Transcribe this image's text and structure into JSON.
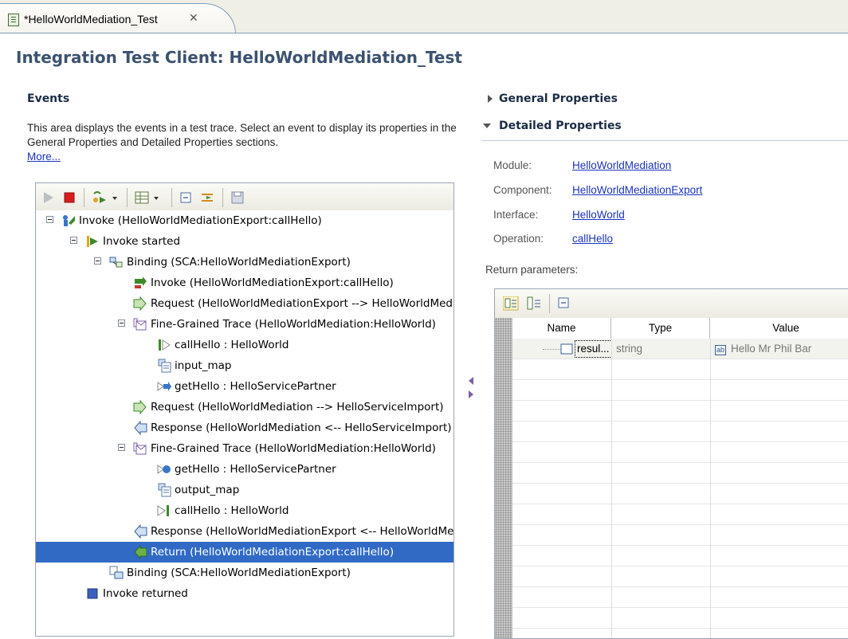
{
  "editor_tab": {
    "label": "*HelloWorldMediation_Test",
    "close_glyph": "✕"
  },
  "page": {
    "title": "Integration Test Client: HelloWorldMediation_Test"
  },
  "events": {
    "title": "Events",
    "description": "This area displays the events in a test trace. Select an event to display its properties in the General Properties and Detailed Properties sections.",
    "more_link": "More...",
    "toolbar": [
      "play-icon",
      "stop-icon",
      "emulate-icon",
      "table-icon",
      "collapse-all-icon",
      "filter-icon",
      "save-icon"
    ],
    "tree": [
      {
        "label": "Invoke (HelloWorldMediationExport:callHello)",
        "icon": "invoke-person-icon",
        "expanded": true,
        "level": 0
      },
      {
        "label": "Invoke started",
        "icon": "invoke-started-icon",
        "expanded": true,
        "level": 1
      },
      {
        "label": "Binding (SCA:HelloWorldMediationExport)",
        "icon": "binding-icon",
        "expanded": true,
        "level": 2
      },
      {
        "label": "Invoke (HelloWorldMediationExport:callHello)",
        "icon": "invoke-arrow-icon",
        "level": 3
      },
      {
        "label": "Request (HelloWorldMediationExport --> HelloWorldMediation)",
        "icon": "request-icon",
        "level": 3
      },
      {
        "label": "Fine-Grained Trace (HelloWorldMediation:HelloWorld)",
        "icon": "fine-grained-trace-icon",
        "expanded": true,
        "level": 3
      },
      {
        "label": "callHello : HelloWorld",
        "icon": "input-node-icon",
        "level": 4
      },
      {
        "label": "input_map",
        "icon": "map-icon",
        "level": 4
      },
      {
        "label": "getHello : HelloServicePartner",
        "icon": "callout-icon",
        "level": 4
      },
      {
        "label": "Request (HelloWorldMediation --> HelloServiceImport)",
        "icon": "request-icon",
        "level": 3
      },
      {
        "label": "Response (HelloWorldMediation <-- HelloServiceImport)",
        "icon": "response-icon",
        "level": 3
      },
      {
        "label": "Fine-Grained Trace (HelloWorldMediation:HelloWorld)",
        "icon": "fine-grained-trace-icon",
        "expanded": true,
        "level": 3
      },
      {
        "label": "getHello : HelloServicePartner",
        "icon": "callout-response-icon",
        "level": 4
      },
      {
        "label": "output_map",
        "icon": "map-icon",
        "level": 4
      },
      {
        "label": "callHello : HelloWorld",
        "icon": "output-node-icon",
        "level": 4
      },
      {
        "label": "Response (HelloWorldMediationExport <-- HelloWorldMediation)",
        "icon": "response-icon",
        "level": 3
      },
      {
        "label": "Return (HelloWorldMediationExport:callHello)",
        "icon": "return-icon",
        "level": 3,
        "selected": true
      },
      {
        "label": "Binding (SCA:HelloWorldMediationExport)",
        "icon": "binding-end-icon",
        "level": 2
      },
      {
        "label": "Invoke returned",
        "icon": "invoke-returned-icon",
        "level": 1
      }
    ]
  },
  "general_properties": {
    "title": "General Properties"
  },
  "detailed_properties": {
    "title": "Detailed Properties",
    "fields": [
      {
        "label": "Module:",
        "value": "HelloWorldMediation"
      },
      {
        "label": "Component:",
        "value": "HelloWorldMediationExport"
      },
      {
        "label": "Interface:",
        "value": "HelloWorld"
      },
      {
        "label": "Operation:",
        "value": "callHello"
      }
    ],
    "return_parameters_label": "Return parameters:",
    "table": {
      "toolbar": [
        "editor-view-icon",
        "tree-view-icon",
        "collapse-icon"
      ],
      "columns": [
        "Name",
        "Type",
        "Value"
      ],
      "rows": [
        {
          "name": "resul...",
          "type": "string",
          "value": "Hello Mr Phil Bar",
          "value_icon": "ab"
        }
      ]
    }
  }
}
